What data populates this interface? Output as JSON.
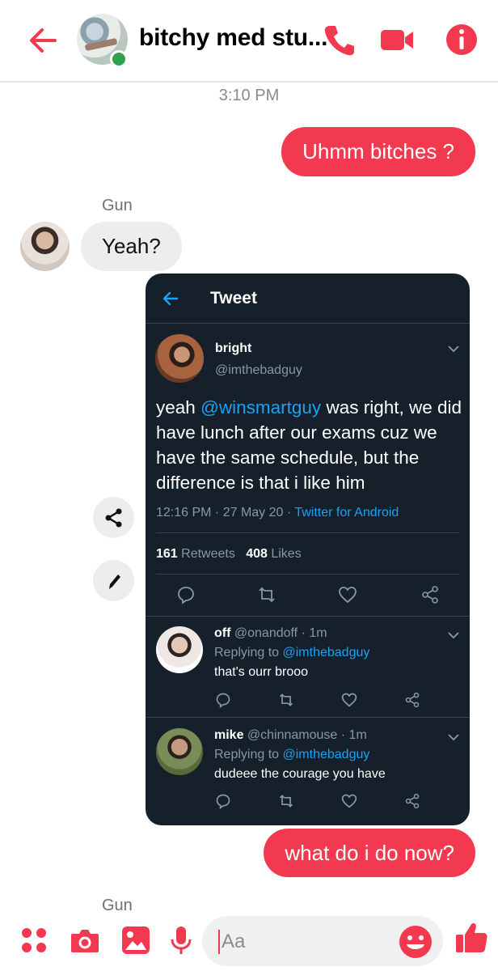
{
  "header": {
    "title": "bitchy med stu...",
    "icons": [
      "arrow-left-icon",
      "phone-icon",
      "video-camera-icon",
      "info-icon"
    ],
    "accent": "#f2394f"
  },
  "messages": {
    "timestamp": "3:10 PM",
    "outgoing_1": "Uhmm bitches ?",
    "sender_1": "Gun",
    "incoming_1": "Yeah?",
    "outgoing_2": "what do i do now?",
    "sender_2": "Gun"
  },
  "tweet": {
    "header_title": "Tweet",
    "author_name": "bright",
    "author_handle": "@imthebadguy",
    "text_before": "yeah ",
    "text_mention": "@winsmartguy",
    "text_after": " was right, we did have lunch after our exams cuz we have the same schedule, but the difference is that i like him",
    "time": "12:16 PM · 27 May 20 · ",
    "source": "Twitter for Android",
    "retweets_count": "161",
    "retweets_label": " Retweets",
    "likes_count": "408",
    "likes_label": " Likes",
    "replies": [
      {
        "name": "off",
        "meta": " @onandoff · 1m",
        "replying_prefix": "Replying to ",
        "replying_to": "@imthebadguy",
        "text": "that's ourr brooo"
      },
      {
        "name": "mike",
        "meta": " @chinnamouse · 1m",
        "replying_prefix": "Replying to ",
        "replying_to": "@imthebadguy",
        "text": "dudeee the courage you have"
      }
    ],
    "colors": {
      "background": "#15202b",
      "link": "#1da1f2",
      "muted": "#8899a6"
    }
  },
  "composer": {
    "placeholder": "Aa",
    "icons": [
      "menu-dots-icon",
      "camera-icon",
      "gallery-icon",
      "microphone-icon",
      "emoji-icon",
      "thumbs-up-icon"
    ]
  }
}
